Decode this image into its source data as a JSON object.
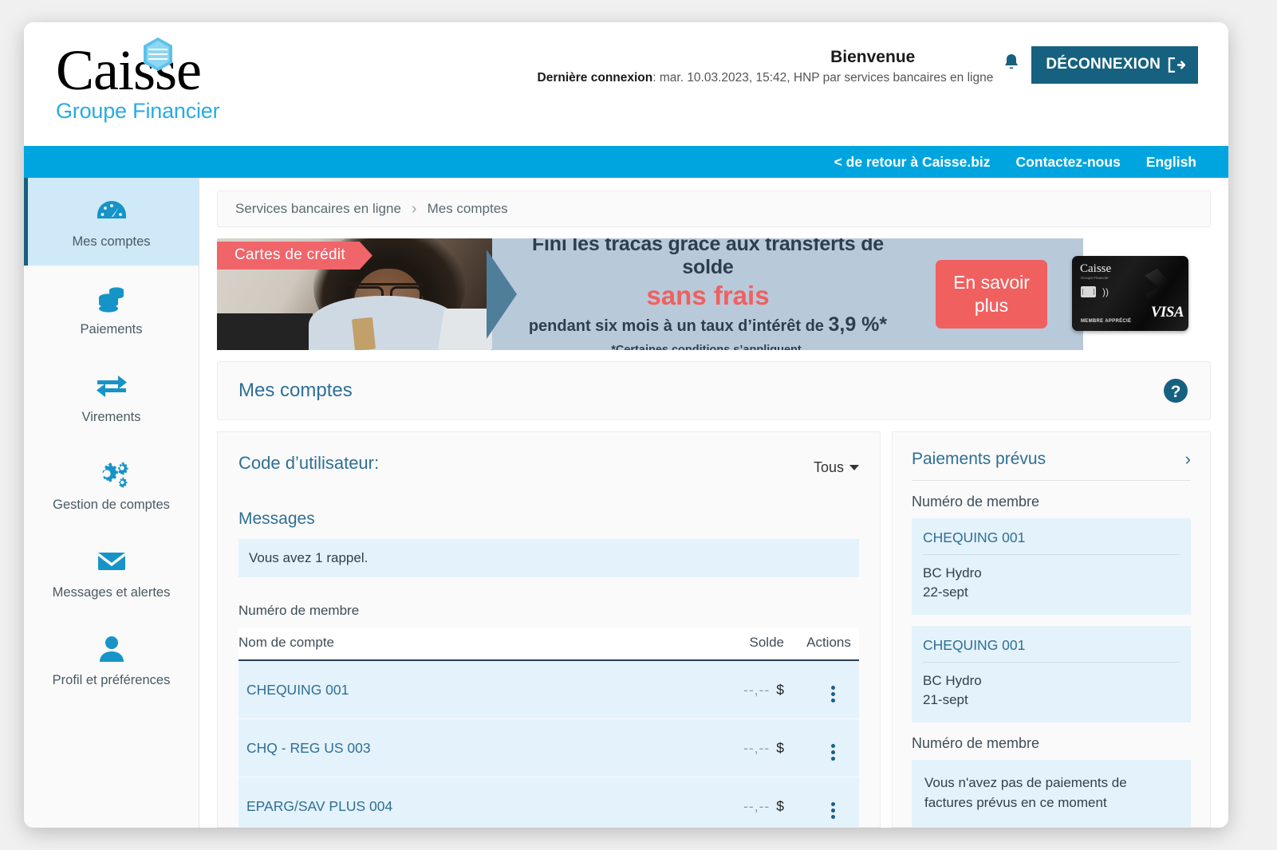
{
  "header": {
    "logo_word": "Caisse",
    "logo_sub": "Groupe Financier",
    "welcome": "Bienvenue",
    "last_login_label": "Dernière connexion",
    "last_login_value": ": mar. 10.03.2023, 15:42, HNP par services bancaires en ligne",
    "logout_label": "DÉCONNEXION",
    "bell_icon": "bell-icon"
  },
  "topnav": {
    "links": [
      "< de retour à Caisse.biz",
      "Contactez-nous",
      "English"
    ]
  },
  "sidebar": {
    "items": [
      {
        "label": "Mes comptes",
        "icon": "dashboard-gauge-icon",
        "active": true
      },
      {
        "label": "Paiements",
        "icon": "coins-stack-icon",
        "active": false
      },
      {
        "label": "Virements",
        "icon": "transfer-arrows-icon",
        "active": false
      },
      {
        "label": "Gestion de comptes",
        "icon": "gears-icon",
        "active": false
      },
      {
        "label": "Messages et alertes",
        "icon": "envelope-icon",
        "active": false
      },
      {
        "label": "Profil et préférences",
        "icon": "user-icon",
        "active": false
      }
    ]
  },
  "breadcrumb": {
    "root": "Services bancaires en ligne",
    "separator": "›",
    "current": "Mes comptes"
  },
  "banner": {
    "tag": "Cartes de crédit",
    "line1": "Fini les tracas grâce aux transferts de solde",
    "line2": "sans frais",
    "line3_pre": "pendant six mois à un taux d’intérêt de ",
    "line3_rate": "3,9 %*",
    "footnote": "*Certaines conditions s’appliquent.",
    "cta_line1": "En savoir",
    "cta_line2": "plus",
    "card_brand": "VISA",
    "card_logo": "Caisse",
    "card_sub": "Groupe Financier",
    "card_member": "MEMBRE APPRÉCIÉ"
  },
  "section": {
    "title": "Mes comptes",
    "help_icon": "help-question-icon"
  },
  "accounts_panel": {
    "user_code_label": "Code d’utilisateur:",
    "filter_value": "Tous",
    "messages_title": "Messages",
    "message_text": "Vous avez 1 rappel.",
    "member_label": "Numéro de membre",
    "columns": [
      "Nom de compte",
      "Solde",
      "Actions"
    ],
    "rows": [
      {
        "name": "CHEQUING 001",
        "balance": "--,--",
        "currency": "$"
      },
      {
        "name": "CHQ - REG US 003",
        "balance": "--,--",
        "currency": "$"
      },
      {
        "name": "EPARG/SAV PLUS 004",
        "balance": "--,--",
        "currency": "$"
      }
    ]
  },
  "payments_panel": {
    "title": "Paiements prévus",
    "chevron": "›",
    "member_label_1": "Numéro de membre",
    "items": [
      {
        "account": "CHEQUING 001",
        "payee": "BC Hydro",
        "date": "22-sept"
      },
      {
        "account": "CHEQUING 001",
        "payee": "BC Hydro",
        "date": "21-sept"
      }
    ],
    "member_label_2": "Numéro de membre",
    "empty_text": "Vous n'avez pas de paiements de factures prévus en ce moment"
  },
  "colors": {
    "cyan": "#00A5E0",
    "teal": "#16617F",
    "link_blue": "#2e6f96",
    "row_blue": "#e4f2fb",
    "accent_red": "#F0605F"
  }
}
